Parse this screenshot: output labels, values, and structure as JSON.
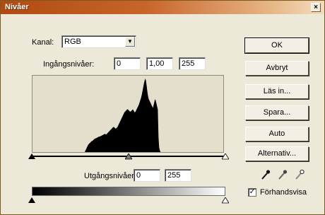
{
  "window": {
    "title": "Nivåer",
    "close_glyph": "×"
  },
  "channel": {
    "label": "Kanal:",
    "value": "RGB",
    "arrow_glyph": "▼"
  },
  "input_levels": {
    "label": "Ingångsnivåer:",
    "black": "0",
    "gamma": "1,00",
    "white": "255"
  },
  "output_levels": {
    "label": "Utgångsnivåer:",
    "black": "0",
    "white": "255"
  },
  "buttons": {
    "ok": "OK",
    "cancel": "Avbryt",
    "load": "Läs in...",
    "save": "Spara...",
    "auto": "Auto",
    "options": "Alternativ..."
  },
  "preview": {
    "label": "Förhandsvisa",
    "checked": true,
    "check_glyph": "✓"
  },
  "eyedroppers": {
    "black": "black-point-eyedropper",
    "gray": "gray-point-eyedropper",
    "white": "white-point-eyedropper"
  },
  "histogram": {
    "bins": 256,
    "heights": [
      0,
      0,
      0,
      0,
      0,
      0,
      0,
      0,
      0,
      0,
      0,
      0,
      0,
      0,
      0,
      0,
      0,
      0,
      0,
      0,
      0,
      0,
      0,
      0,
      0,
      0,
      0,
      0,
      0,
      0,
      0,
      0,
      0,
      0,
      0,
      0,
      0,
      0,
      0,
      0,
      0,
      0,
      0,
      0,
      0,
      0,
      0,
      0,
      0,
      0,
      0,
      0,
      0,
      0,
      0,
      0,
      0,
      0,
      0,
      0,
      0,
      0,
      0,
      0,
      0,
      0,
      0,
      0,
      0,
      0,
      0,
      0,
      0,
      0,
      0,
      0,
      0.02,
      0.04,
      0.06,
      0.08,
      0.1,
      0.11,
      0.12,
      0.13,
      0.14,
      0.15,
      0.15,
      0.16,
      0.17,
      0.18,
      0.18,
      0.19,
      0.19,
      0.2,
      0.2,
      0.21,
      0.21,
      0.21,
      0.22,
      0.22,
      0.23,
      0.23,
      0.24,
      0.24,
      0.25,
      0.24,
      0.24,
      0.25,
      0.26,
      0.27,
      0.28,
      0.29,
      0.3,
      0.31,
      0.32,
      0.33,
      0.34,
      0.34,
      0.33,
      0.32,
      0.32,
      0.33,
      0.34,
      0.36,
      0.38,
      0.4,
      0.42,
      0.44,
      0.46,
      0.48,
      0.5,
      0.52,
      0.54,
      0.55,
      0.56,
      0.57,
      0.58,
      0.58,
      0.57,
      0.56,
      0.55,
      0.55,
      0.56,
      0.57,
      0.58,
      0.57,
      0.55,
      0.54,
      0.55,
      0.57,
      0.59,
      0.61,
      0.63,
      0.65,
      0.68,
      0.71,
      0.74,
      0.78,
      0.83,
      0.88,
      0.93,
      0.97,
      1.0,
      0.97,
      0.9,
      0.82,
      0.76,
      0.72,
      0.7,
      0.68,
      0.66,
      0.64,
      0.62,
      0.6,
      0.64,
      0.68,
      0.72,
      0.7,
      0.66,
      0.62,
      0.58,
      0.2,
      0.06,
      0.02,
      0,
      0,
      0,
      0,
      0,
      0,
      0,
      0,
      0,
      0,
      0,
      0,
      0,
      0,
      0,
      0,
      0,
      0,
      0,
      0,
      0,
      0,
      0,
      0,
      0,
      0,
      0,
      0,
      0,
      0,
      0,
      0,
      0,
      0,
      0,
      0,
      0,
      0,
      0,
      0,
      0,
      0,
      0,
      0,
      0,
      0,
      0,
      0,
      0,
      0,
      0,
      0,
      0,
      0,
      0,
      0,
      0,
      0,
      0,
      0,
      0,
      0,
      0,
      0,
      0,
      0,
      0,
      0,
      0,
      0,
      0,
      0,
      0,
      0,
      0,
      0,
      0,
      0,
      0,
      0,
      0,
      0,
      0,
      0,
      0,
      0,
      0,
      0,
      0,
      0,
      0
    ]
  },
  "sliders": {
    "input_black": 0,
    "input_gamma": 1.0,
    "input_white": 255,
    "output_black": 0,
    "output_white": 255
  }
}
